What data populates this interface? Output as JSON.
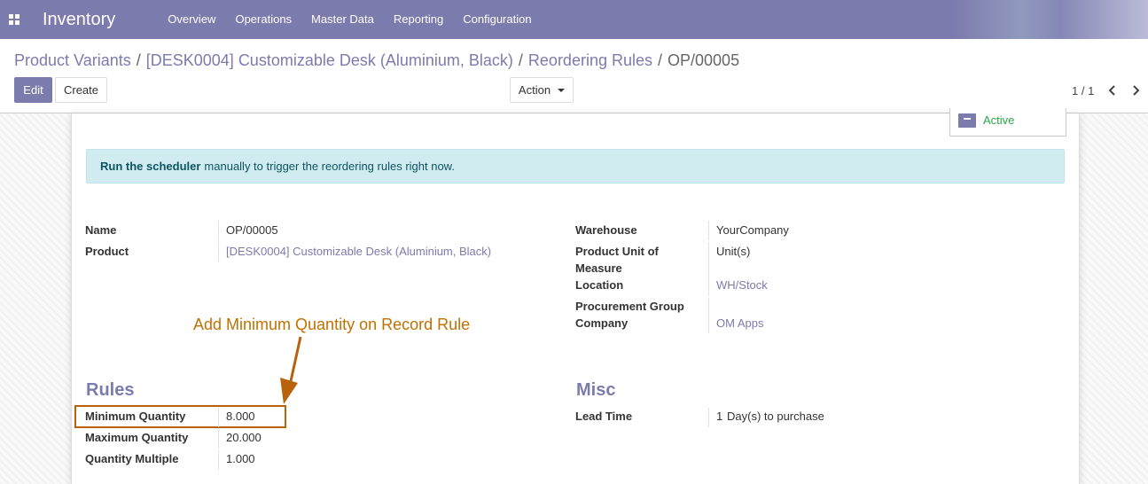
{
  "navbar": {
    "app_title": "Inventory",
    "menu": [
      "Overview",
      "Operations",
      "Master Data",
      "Reporting",
      "Configuration"
    ]
  },
  "breadcrumb": {
    "items": [
      "Product Variants",
      "[DESK0004] Customizable Desk (Aluminium, Black)",
      "Reordering Rules"
    ],
    "separator": "/",
    "current": "OP/00005"
  },
  "buttons": {
    "edit": "Edit",
    "create": "Create",
    "action": "Action"
  },
  "pager": {
    "text": "1 / 1"
  },
  "status_button": {
    "label": "Active"
  },
  "alert": {
    "bold": "Run the scheduler",
    "text": "manually to trigger the reordering rules right now."
  },
  "fields_left": {
    "name_label": "Name",
    "name_value": "OP/00005",
    "product_label": "Product",
    "product_value": "[DESK0004] Customizable Desk (Aluminium, Black)"
  },
  "fields_right": {
    "warehouse_label": "Warehouse",
    "warehouse_value": "YourCompany",
    "uom_label_1": "Product Unit of",
    "uom_label_2": "Measure",
    "uom_value": "Unit(s)",
    "location_label": "Location",
    "location_value": "WH/Stock",
    "procurement_label": "Procurement Group",
    "company_label": "Company",
    "company_value": "OM Apps"
  },
  "rules": {
    "title": "Rules",
    "min_label": "Minimum Quantity",
    "min_value": "8.000",
    "max_label": "Maximum Quantity",
    "max_value": "20.000",
    "mult_label": "Quantity Multiple",
    "mult_value": "1.000"
  },
  "misc": {
    "title": "Misc",
    "lead_label": "Lead Time",
    "lead_value": "1",
    "lead_unit": "Day(s) to purchase"
  },
  "annotation": {
    "text": "Add Minimum Quantity on Record Rule",
    "color": "#c07000"
  },
  "colors": {
    "brand": "#7c7bad",
    "active": "#28a745",
    "alert_bg": "#d1ecf1"
  }
}
